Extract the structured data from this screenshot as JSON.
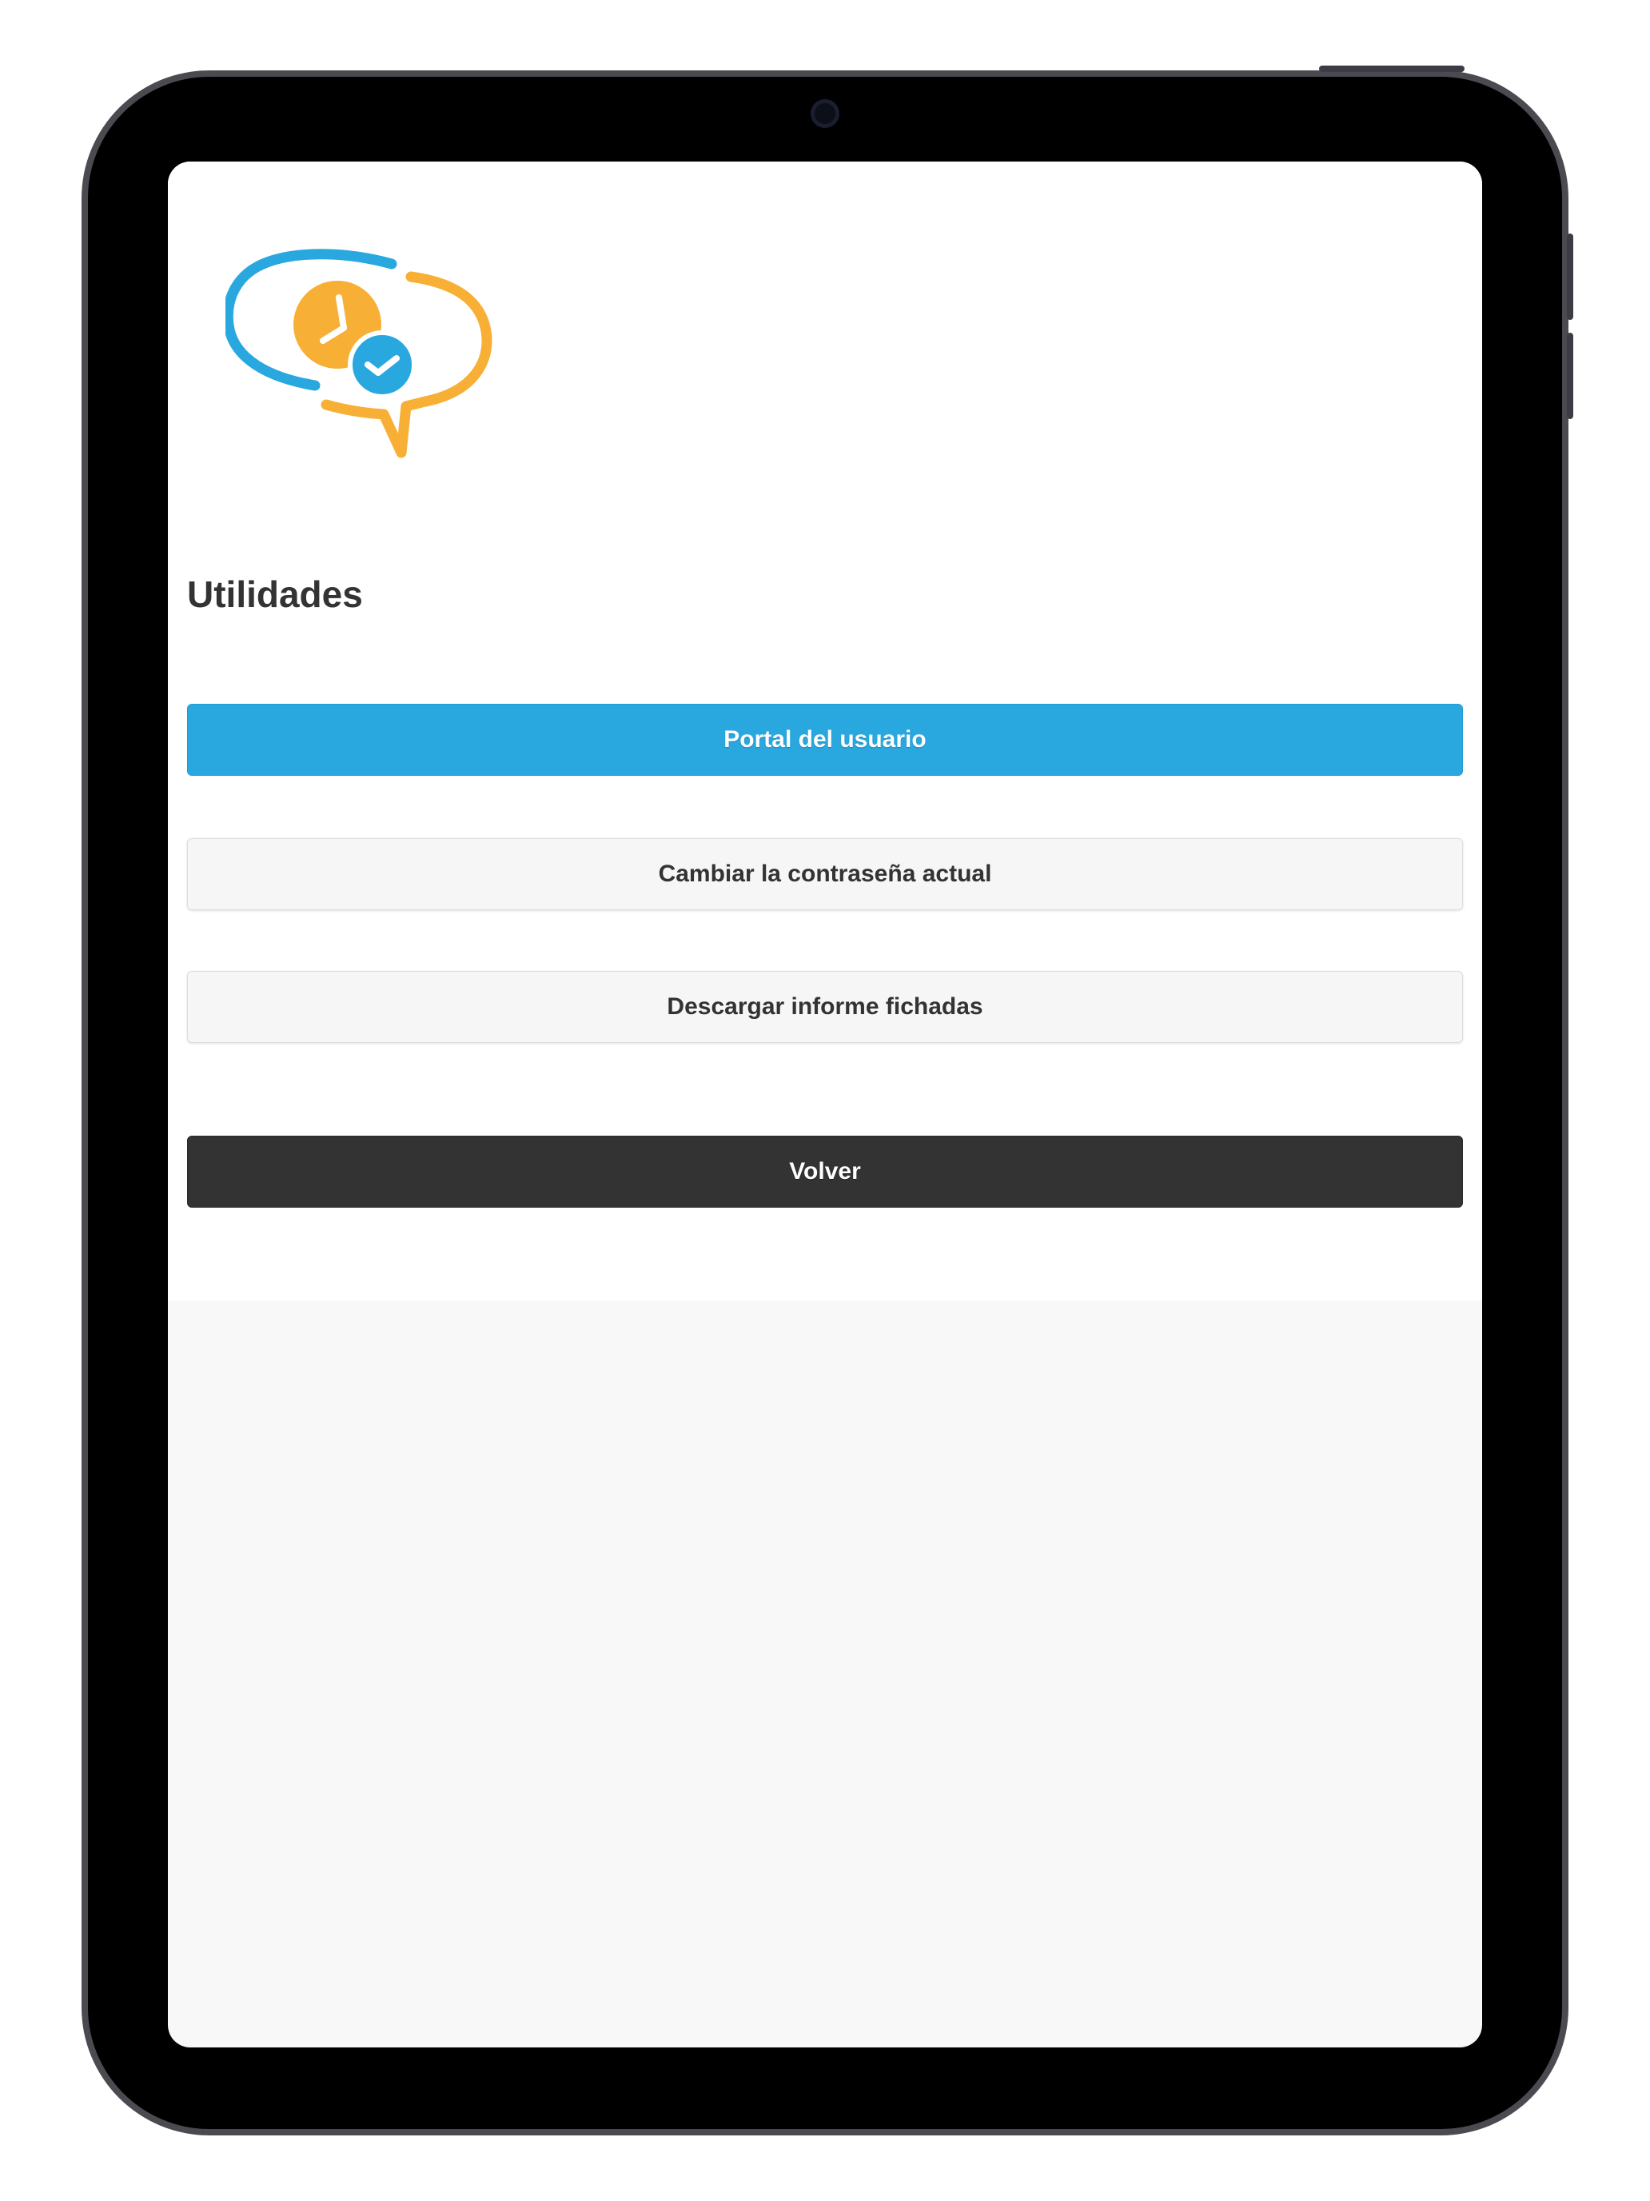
{
  "app": {
    "logo_icon": "clock-check-speech-bubble-logo",
    "colors": {
      "logo_blue": "#29a8e0",
      "logo_orange": "#f7b035"
    }
  },
  "page": {
    "title": "Utilidades"
  },
  "actions": {
    "user_portal_label": "Portal del usuario",
    "change_password_label": "Cambiar la contraseña actual",
    "download_report_label": "Descargar informe fichadas",
    "back_label": "Volver"
  },
  "theme": {
    "primary": "#29a8e0",
    "secondary_bg": "#f6f6f6",
    "dark": "#333333"
  }
}
